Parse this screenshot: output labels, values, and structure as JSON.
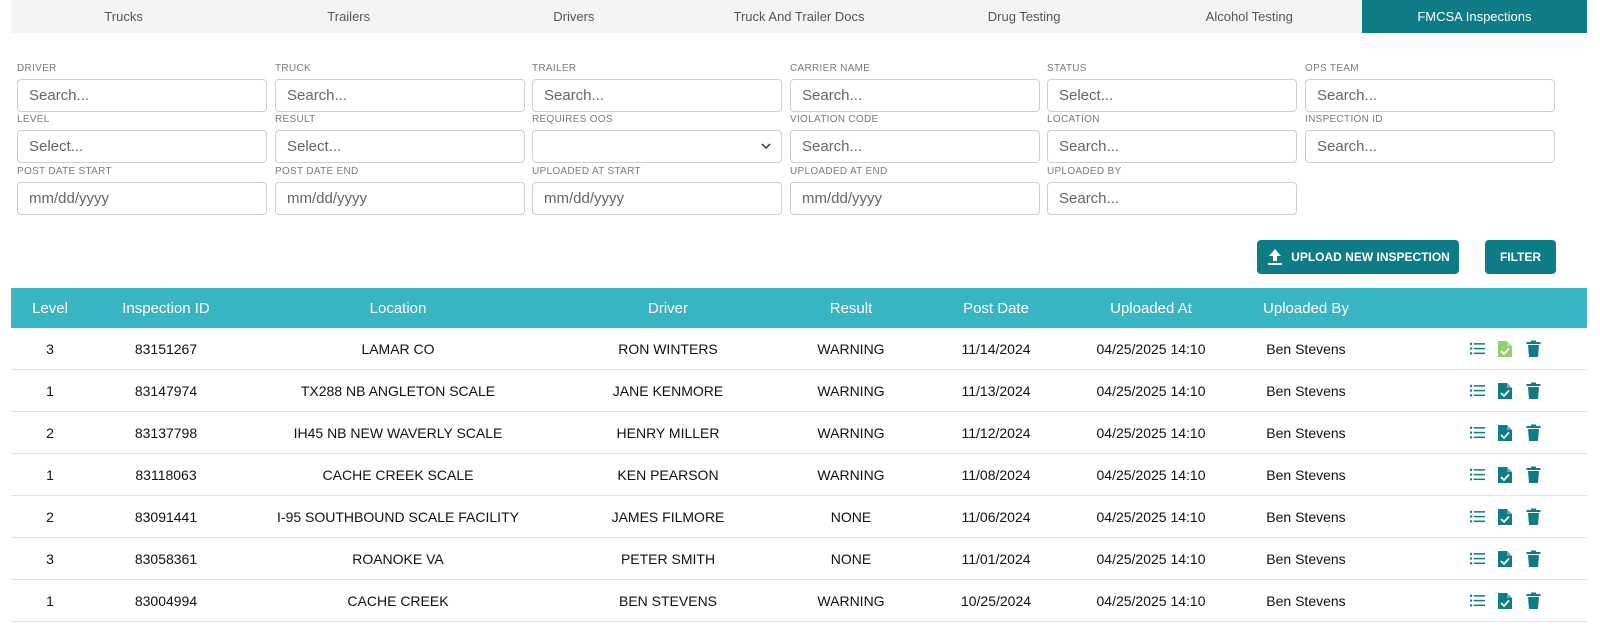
{
  "tabs": [
    {
      "label": "Trucks"
    },
    {
      "label": "Trailers"
    },
    {
      "label": "Drivers"
    },
    {
      "label": "Truck And Trailer Docs"
    },
    {
      "label": "Drug Testing"
    },
    {
      "label": "Alcohol Testing"
    },
    {
      "label": "FMCSA Inspections"
    }
  ],
  "active_tab": "FMCSA Inspections",
  "filters": {
    "driver": {
      "label": "DRIVER",
      "placeholder": "Search..."
    },
    "truck": {
      "label": "TRUCK",
      "placeholder": "Search..."
    },
    "trailer": {
      "label": "TRAILER",
      "placeholder": "Search..."
    },
    "carrier_name": {
      "label": "CARRIER NAME",
      "placeholder": "Search..."
    },
    "status": {
      "label": "STATUS",
      "placeholder": "Select..."
    },
    "ops_team": {
      "label": "OPS TEAM",
      "placeholder": "Search..."
    },
    "level": {
      "label": "LEVEL",
      "placeholder": "Select..."
    },
    "result": {
      "label": "RESULT",
      "placeholder": "Select..."
    },
    "requires_oos": {
      "label": "REQUIRES OOS",
      "value": ""
    },
    "violation_code": {
      "label": "VIOLATION CODE",
      "placeholder": "Search..."
    },
    "location": {
      "label": "LOCATION",
      "placeholder": "Search..."
    },
    "inspection_id": {
      "label": "INSPECTION ID",
      "placeholder": "Search..."
    },
    "post_date_start": {
      "label": "POST DATE START",
      "placeholder": "mm/dd/yyyy"
    },
    "post_date_end": {
      "label": "POST DATE END",
      "placeholder": "mm/dd/yyyy"
    },
    "uploaded_at_start": {
      "label": "UPLOADED AT START",
      "placeholder": "mm/dd/yyyy"
    },
    "uploaded_at_end": {
      "label": "UPLOADED AT END",
      "placeholder": "mm/dd/yyyy"
    },
    "uploaded_by": {
      "label": "UPLOADED BY",
      "placeholder": "Search..."
    }
  },
  "actions": {
    "upload_label": "UPLOAD NEW INSPECTION",
    "filter_label": "FILTER"
  },
  "table": {
    "headers": {
      "level": "Level",
      "inspection_id": "Inspection ID",
      "location": "Location",
      "driver": "Driver",
      "result": "Result",
      "post_date": "Post Date",
      "uploaded_at": "Uploaded At",
      "uploaded_by": "Uploaded By"
    },
    "rows": [
      {
        "level": "3",
        "inspection_id": "83151267",
        "location": "LAMAR CO",
        "driver": "RON WINTERS",
        "result": "WARNING",
        "post_date": "11/14/2024",
        "uploaded_at": "04/25/2025 14:10",
        "uploaded_by": "Ben Stevens",
        "doc_icon": "doc-check-icon-light"
      },
      {
        "level": "1",
        "inspection_id": "83147974",
        "location": "TX288 NB ANGLETON SCALE",
        "driver": "JANE KENMORE",
        "result": "WARNING",
        "post_date": "11/13/2024",
        "uploaded_at": "04/25/2025 14:10",
        "uploaded_by": "Ben Stevens",
        "doc_icon": "doc-check-icon"
      },
      {
        "level": "2",
        "inspection_id": "83137798",
        "location": "IH45 NB NEW WAVERLY SCALE",
        "driver": "HENRY MILLER",
        "result": "WARNING",
        "post_date": "11/12/2024",
        "uploaded_at": "04/25/2025 14:10",
        "uploaded_by": "Ben Stevens",
        "doc_icon": "doc-check-icon"
      },
      {
        "level": "1",
        "inspection_id": "83118063",
        "location": "CACHE CREEK SCALE",
        "driver": "KEN PEARSON",
        "result": "WARNING",
        "post_date": "11/08/2024",
        "uploaded_at": "04/25/2025 14:10",
        "uploaded_by": "Ben Stevens",
        "doc_icon": "doc-check-icon"
      },
      {
        "level": "2",
        "inspection_id": "83091441",
        "location": "I-95 SOUTHBOUND SCALE FACILITY",
        "driver": "JAMES FILMORE",
        "result": "NONE",
        "post_date": "11/06/2024",
        "uploaded_at": "04/25/2025 14:10",
        "uploaded_by": "Ben Stevens",
        "doc_icon": "doc-check-icon"
      },
      {
        "level": "3",
        "inspection_id": "83058361",
        "location": "ROANOKE VA",
        "driver": "PETER SMITH",
        "result": "NONE",
        "post_date": "11/01/2024",
        "uploaded_at": "04/25/2025 14:10",
        "uploaded_by": "Ben Stevens",
        "doc_icon": "doc-check-icon"
      },
      {
        "level": "1",
        "inspection_id": "83004994",
        "location": "CACHE CREEK",
        "driver": "BEN STEVENS",
        "result": "WARNING",
        "post_date": "10/25/2024",
        "uploaded_at": "04/25/2025 14:10",
        "uploaded_by": "Ben Stevens",
        "doc_icon": "doc-check-icon"
      }
    ],
    "row_icons": [
      "list-icon",
      "doc-check-icon",
      "trash-icon"
    ]
  },
  "colors": {
    "accent": "#0e7c86",
    "table_header": "#38b4c3",
    "doc_icon_light": "#8fcf6d"
  }
}
